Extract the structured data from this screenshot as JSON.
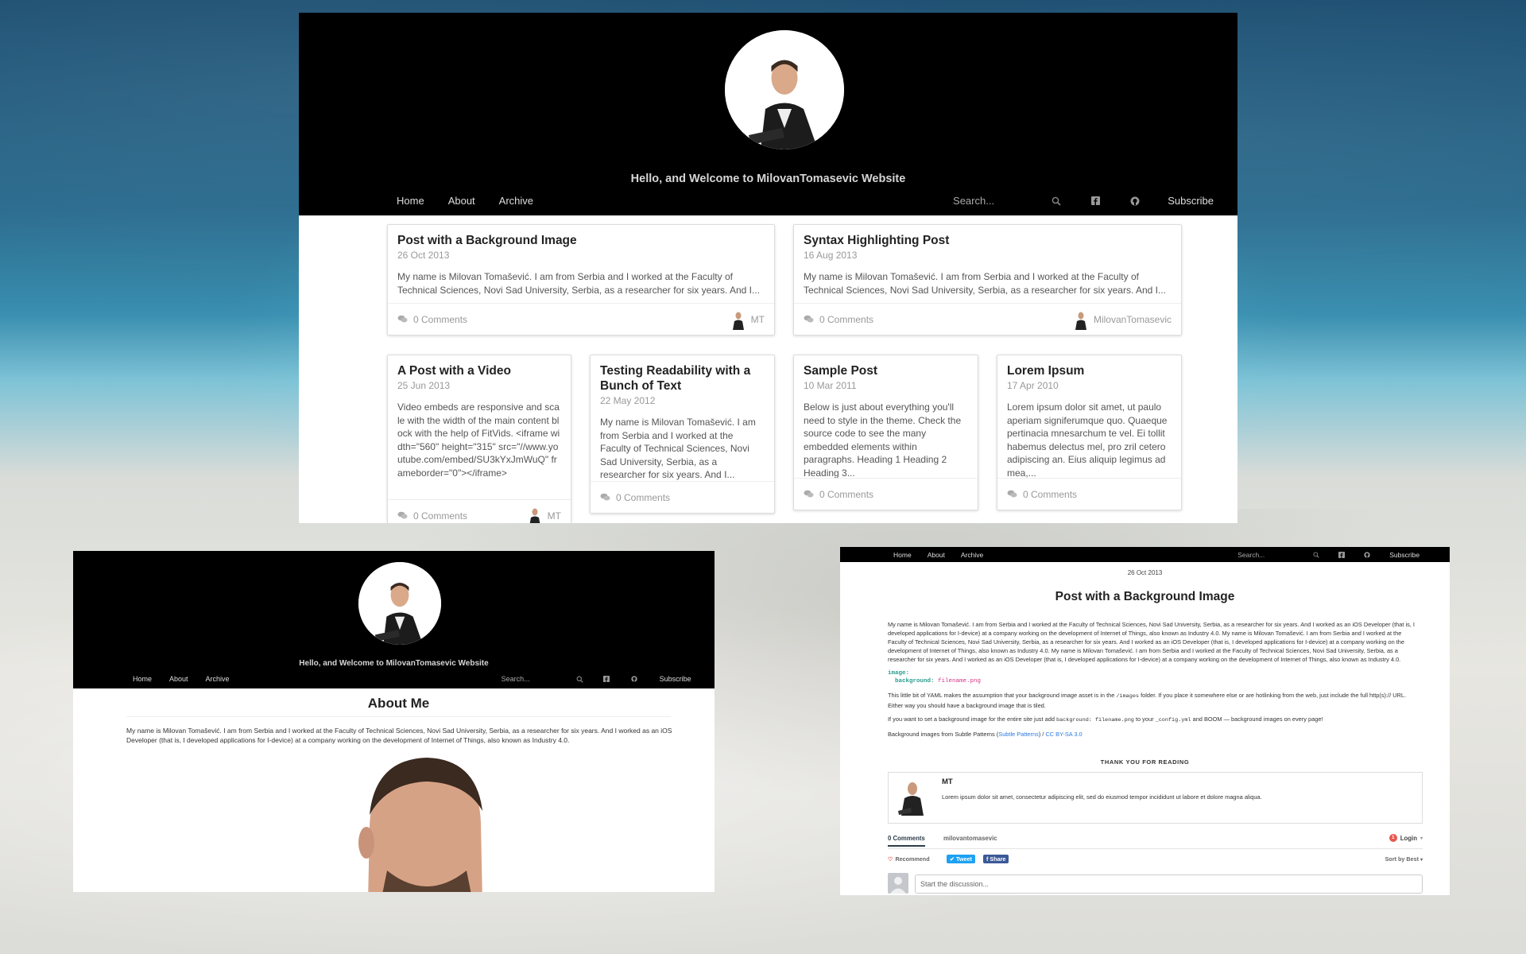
{
  "site": {
    "title": "Hello, and Welcome to MilovanTomasevic Website",
    "nav": {
      "home": "Home",
      "about": "About",
      "archive": "Archive",
      "search_placeholder": "Search...",
      "subscribe": "Subscribe"
    }
  },
  "icons": {
    "search": "search-icon",
    "facebook": "facebook-icon",
    "github": "github-icon",
    "comments": "comments-icon"
  },
  "posts": [
    {
      "title": "Post with a Background Image",
      "date": "26 Oct 2013",
      "excerpt": "My name is Milovan Tomašević. I am from Serbia and I worked at the Faculty of Technical Sciences, Novi Sad University, Serbia, as a researcher for six years. And I...",
      "comments": "0 Comments",
      "author": "MT"
    },
    {
      "title": "Syntax Highlighting Post",
      "date": "16 Aug 2013",
      "excerpt": "My name is Milovan Tomašević. I am from Serbia and I worked at the Faculty of Technical Sciences, Novi Sad University, Serbia, as a researcher for six years. And I...",
      "comments": "0 Comments",
      "author": "MilovanTomasevic"
    },
    {
      "title": "A Post with a Video",
      "date": "25 Jun 2013",
      "excerpt": "Video embeds are responsive and scale with the width of the main content block with the help of FitVids. <iframe width=\"560\" height=\"315\" src=\"//www.youtube.com/embed/SU3kYxJmWuQ\" frameborder=\"0\"></iframe>",
      "comments": "0 Comments",
      "author": "MT"
    },
    {
      "title": "Testing Readability with a Bunch of Text",
      "date": "22 May 2012",
      "excerpt": "My name is Milovan Tomašević. I am from Serbia and I worked at the Faculty of Technical Sciences, Novi Sad University, Serbia, as a researcher for six years. And I...",
      "comments": "0 Comments",
      "author": ""
    },
    {
      "title": "Sample Post",
      "date": "10 Mar 2011",
      "excerpt": "Below is just about everything you'll need to style in the theme. Check the source code to see the many embedded elements within paragraphs. Heading 1 Heading 2 Heading 3...",
      "comments": "0 Comments",
      "author": ""
    },
    {
      "title": "Lorem Ipsum",
      "date": "17 Apr 2010",
      "excerpt": "Lorem ipsum dolor sit amet, ut paulo aperiam signiferumque quo. Quaeque pertinacia mnesarchum te vel. Ei tollit habemus delectus mel, pro zril cetero adipiscing an. Eius aliquip legimus ad mea,...",
      "comments": "0 Comments",
      "author": ""
    }
  ],
  "about": {
    "heading": "About Me",
    "body": "My name is Milovan Tomašević. I am from Serbia and I worked at the Faculty of Technical Sciences, Novi Sad University, Serbia, as a researcher for six years. And I worked as an iOS Developer (that is, I developed applications for I-device) at a company working on the development of Internet of Things, also known as Industry 4.0."
  },
  "post": {
    "date": "26 Oct 2013",
    "title": "Post with a Background Image",
    "body": "My name is Milovan Tomašević. I am from Serbia and I worked at the Faculty of Technical Sciences, Novi Sad University, Serbia, as a researcher for six years. And I worked as an iOS Developer (that is, I developed applications for I-device) at a company working on the development of Internet of Things, also known as Industry 4.0. My name is Milovan Tomašević. I am from Serbia and I worked at the Faculty of Technical Sciences, Novi Sad University, Serbia, as a researcher for six years. And I worked as an iOS Developer (that is, I developed applications for I-device) at a company working on the development of Internet of Things, also known as Industry 4.0. My name is Milovan Tomašević. I am from Serbia and I worked at the Faculty of Technical Sciences, Novi Sad University, Serbia, as a researcher for six years. And I worked as an iOS Developer (that is, I developed applications for I-device) at a company working on the development of Internet of Things, also known as Industry 4.0.",
    "code_line1": "image:",
    "code_key": "background:",
    "code_val": "filename.png",
    "yaml_a": "This little bit of YAML makes the assumption that your background image asset is in the",
    "yaml_code": "/images",
    "yaml_b": "folder. If you place it somewhere else or are hotlinking from the web, just include the full http(s):// URL. Either way you should have a background image that is tiled.",
    "site_a": "If you want to set a background image for the entire site just add",
    "site_code1": "background: filename.png",
    "site_b": "to your",
    "site_code2": "_config.yml",
    "site_c": "and BOOM — background images on every page!",
    "credits_a": "Background images from Subtle Patterns (",
    "credits_link1": "Subtle Patterns",
    "credits_b": ") /",
    "credits_link2": "CC BY-SA 3.0",
    "thanks": "THANK YOU FOR READING",
    "author_name": "MT",
    "author_bio": "Lorem ipsum dolor sit amet, consectetur adipiscing elit, sed do eiusmod tempor incididunt ut labore et dolore magna aliqua.",
    "disqus": {
      "comments_tab": "0 Comments",
      "community_tab": "milovantomasevic",
      "notif": "1",
      "login": "Login",
      "recommend": "Recommend",
      "tweet": "Tweet",
      "share": "Share",
      "sort": "Sort by Best",
      "placeholder": "Start the discussion..."
    }
  }
}
